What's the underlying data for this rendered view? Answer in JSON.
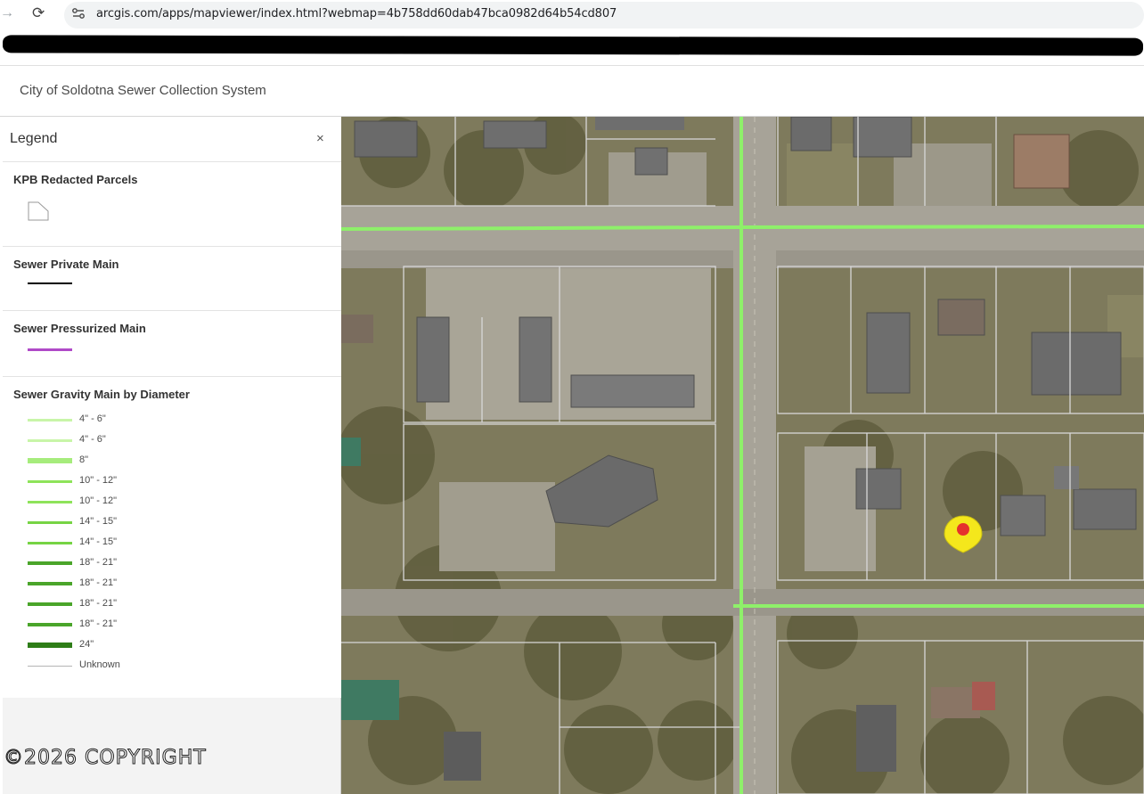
{
  "browser": {
    "url": "arcgis.com/apps/mapviewer/index.html?webmap=4b758dd60dab47bca0982d64b54cd807"
  },
  "app": {
    "title": "City of Soldotna Sewer Collection System"
  },
  "legend": {
    "title": "Legend",
    "close_icon": "×",
    "sections": {
      "parcels": {
        "title": "KPB Redacted Parcels",
        "swatch": "parcel-polygon-icon"
      },
      "private_main": {
        "title": "Sewer Private Main",
        "color": "#000000"
      },
      "pressurized_main": {
        "title": "Sewer Pressurized Main",
        "color": "#b04ac8"
      },
      "gravity_main": {
        "title": "Sewer Gravity Main by Diameter",
        "items": [
          {
            "label": "4\" - 6\"",
            "color": "#c8f5a8"
          },
          {
            "label": "4\" - 6\"",
            "color": "#c8f5a8"
          },
          {
            "label": "8\"",
            "color": "#a6ec7c"
          },
          {
            "label": "10\" - 12\"",
            "color": "#8ee35a"
          },
          {
            "label": "10\" - 12\"",
            "color": "#8ee35a"
          },
          {
            "label": "14\" - 15\"",
            "color": "#76d444"
          },
          {
            "label": "14\" - 15\"",
            "color": "#76d444"
          },
          {
            "label": "18\" - 21\"",
            "color": "#4aa52a"
          },
          {
            "label": "18\" - 21\"",
            "color": "#4aa52a"
          },
          {
            "label": "18\" - 21\"",
            "color": "#4aa52a"
          },
          {
            "label": "18\" - 21\"",
            "color": "#4aa52a"
          },
          {
            "label": "24\"",
            "color": "#2e7d17"
          },
          {
            "label": "Unknown",
            "color": "#b5b5b5"
          }
        ]
      }
    }
  },
  "watermark": "©2026 COPYRIGHT",
  "map": {
    "marker_color": "#f4e71c",
    "marker_dot": "#e5322d",
    "sewer_line_color": "#8ef06a"
  }
}
